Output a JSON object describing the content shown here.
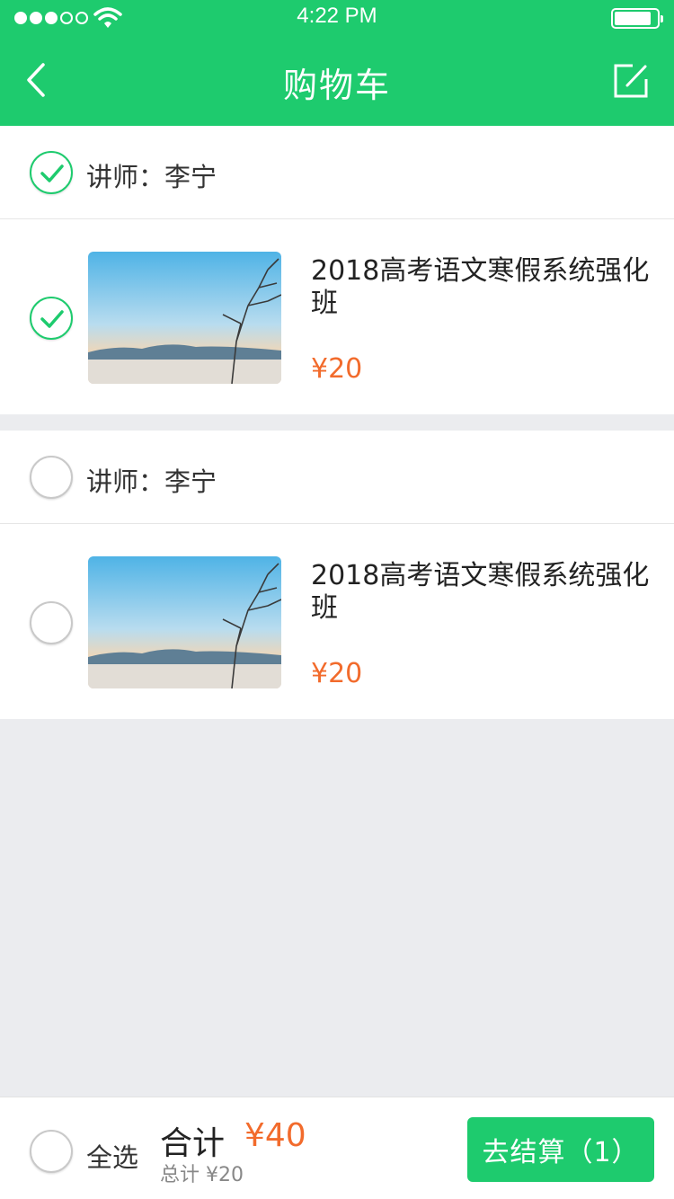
{
  "status_bar": {
    "time": "4:22 PM"
  },
  "nav": {
    "title": "购物车"
  },
  "groups": [
    {
      "teacher": "讲师：李宁",
      "selected": true,
      "item": {
        "title": "2018高考语文寒假系统强化班",
        "price": "¥20",
        "selected": true
      }
    },
    {
      "teacher": "讲师：李宁",
      "selected": false,
      "item": {
        "title": "2018高考语文寒假系统强化班",
        "price": "¥20",
        "selected": false
      }
    }
  ],
  "footer": {
    "select_all": "全选",
    "sum_label": "合计",
    "sum_value": "¥40",
    "total_line": "总计 ¥20",
    "checkout": "去结算（1）"
  },
  "colors": {
    "accent": "#1ecb6e",
    "price": "#f26b2c",
    "background": "#ebecef"
  }
}
